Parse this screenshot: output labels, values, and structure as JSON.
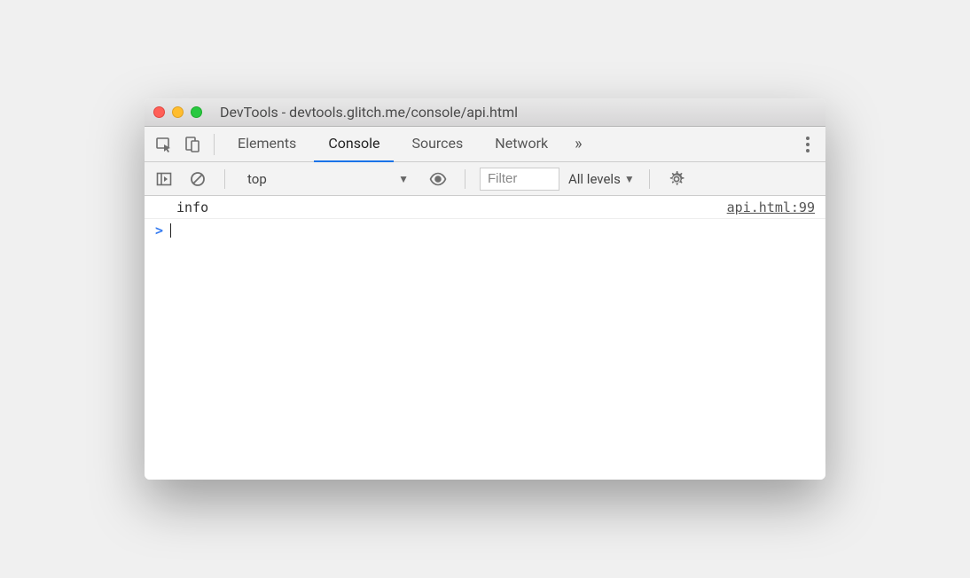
{
  "window": {
    "title": "DevTools - devtools.glitch.me/console/api.html"
  },
  "tabs": {
    "items": [
      "Elements",
      "Console",
      "Sources",
      "Network"
    ],
    "active_index": 1
  },
  "toolbar": {
    "context": "top",
    "filter_placeholder": "Filter",
    "levels_label": "All levels"
  },
  "console": {
    "rows": [
      {
        "message": "info",
        "source": "api.html:99"
      }
    ],
    "prompt": ">"
  }
}
